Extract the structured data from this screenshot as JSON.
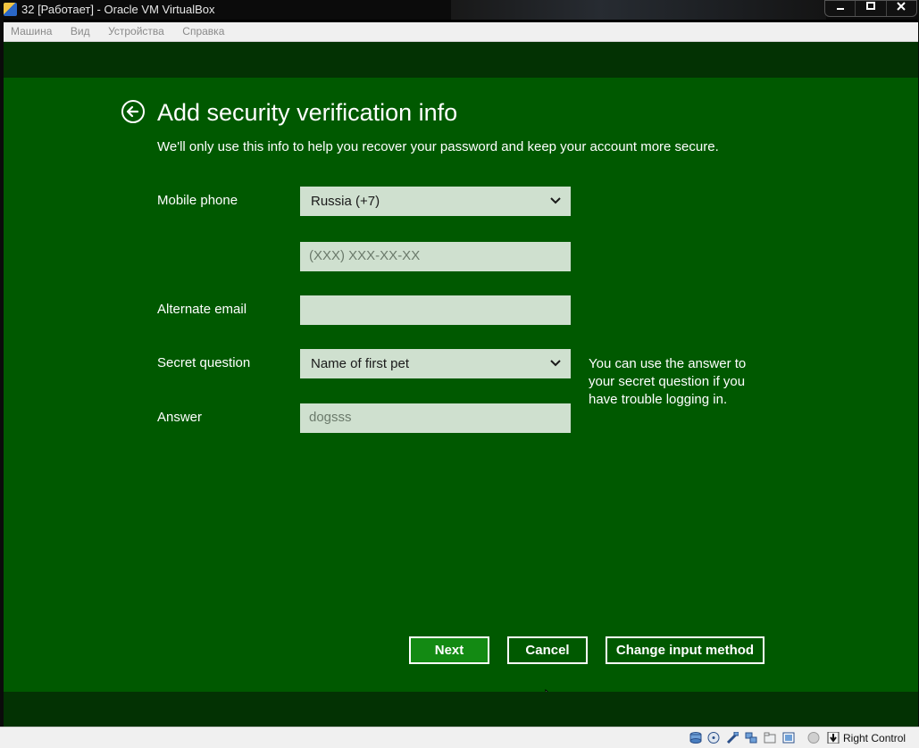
{
  "window": {
    "title": "32 [Работает] - Oracle VM VirtualBox",
    "controls": [
      "minimize",
      "maximize",
      "close"
    ]
  },
  "menubar": {
    "items": [
      {
        "label": "Машина"
      },
      {
        "label": "Вид"
      },
      {
        "label": "Устройства"
      },
      {
        "label": "Справка"
      }
    ]
  },
  "guest": {
    "colors": {
      "background": "#005900",
      "band": "#033203",
      "field": "#cfe0cf",
      "next_button": "#138a13"
    },
    "header": {
      "title": "Add security verification info",
      "subtitle": "We'll only use this info to help you recover your password and keep your account more secure."
    },
    "form": {
      "mobile_phone_label": "Mobile phone",
      "country_value": "Russia (+7)",
      "phone_placeholder": "(XXX) XXX-XX-XX",
      "alternate_email_label": "Alternate email",
      "alternate_email_value": "",
      "secret_question_label": "Secret question",
      "secret_question_value": "Name of first pet",
      "answer_label": "Answer",
      "answer_value": "dogsss",
      "help_text": "You can use the answer to your secret question if you have trouble logging in."
    },
    "buttons": {
      "next": "Next",
      "cancel": "Cancel",
      "change_input": "Change input method"
    }
  },
  "statusbar": {
    "icons": [
      "hard-disk-icon",
      "optical-drive-icon",
      "usb-icon",
      "network-icon",
      "shared-folders-icon",
      "display-icon",
      "recording-icon",
      "mouse-integration-icon"
    ],
    "host_key": "Right Control"
  }
}
